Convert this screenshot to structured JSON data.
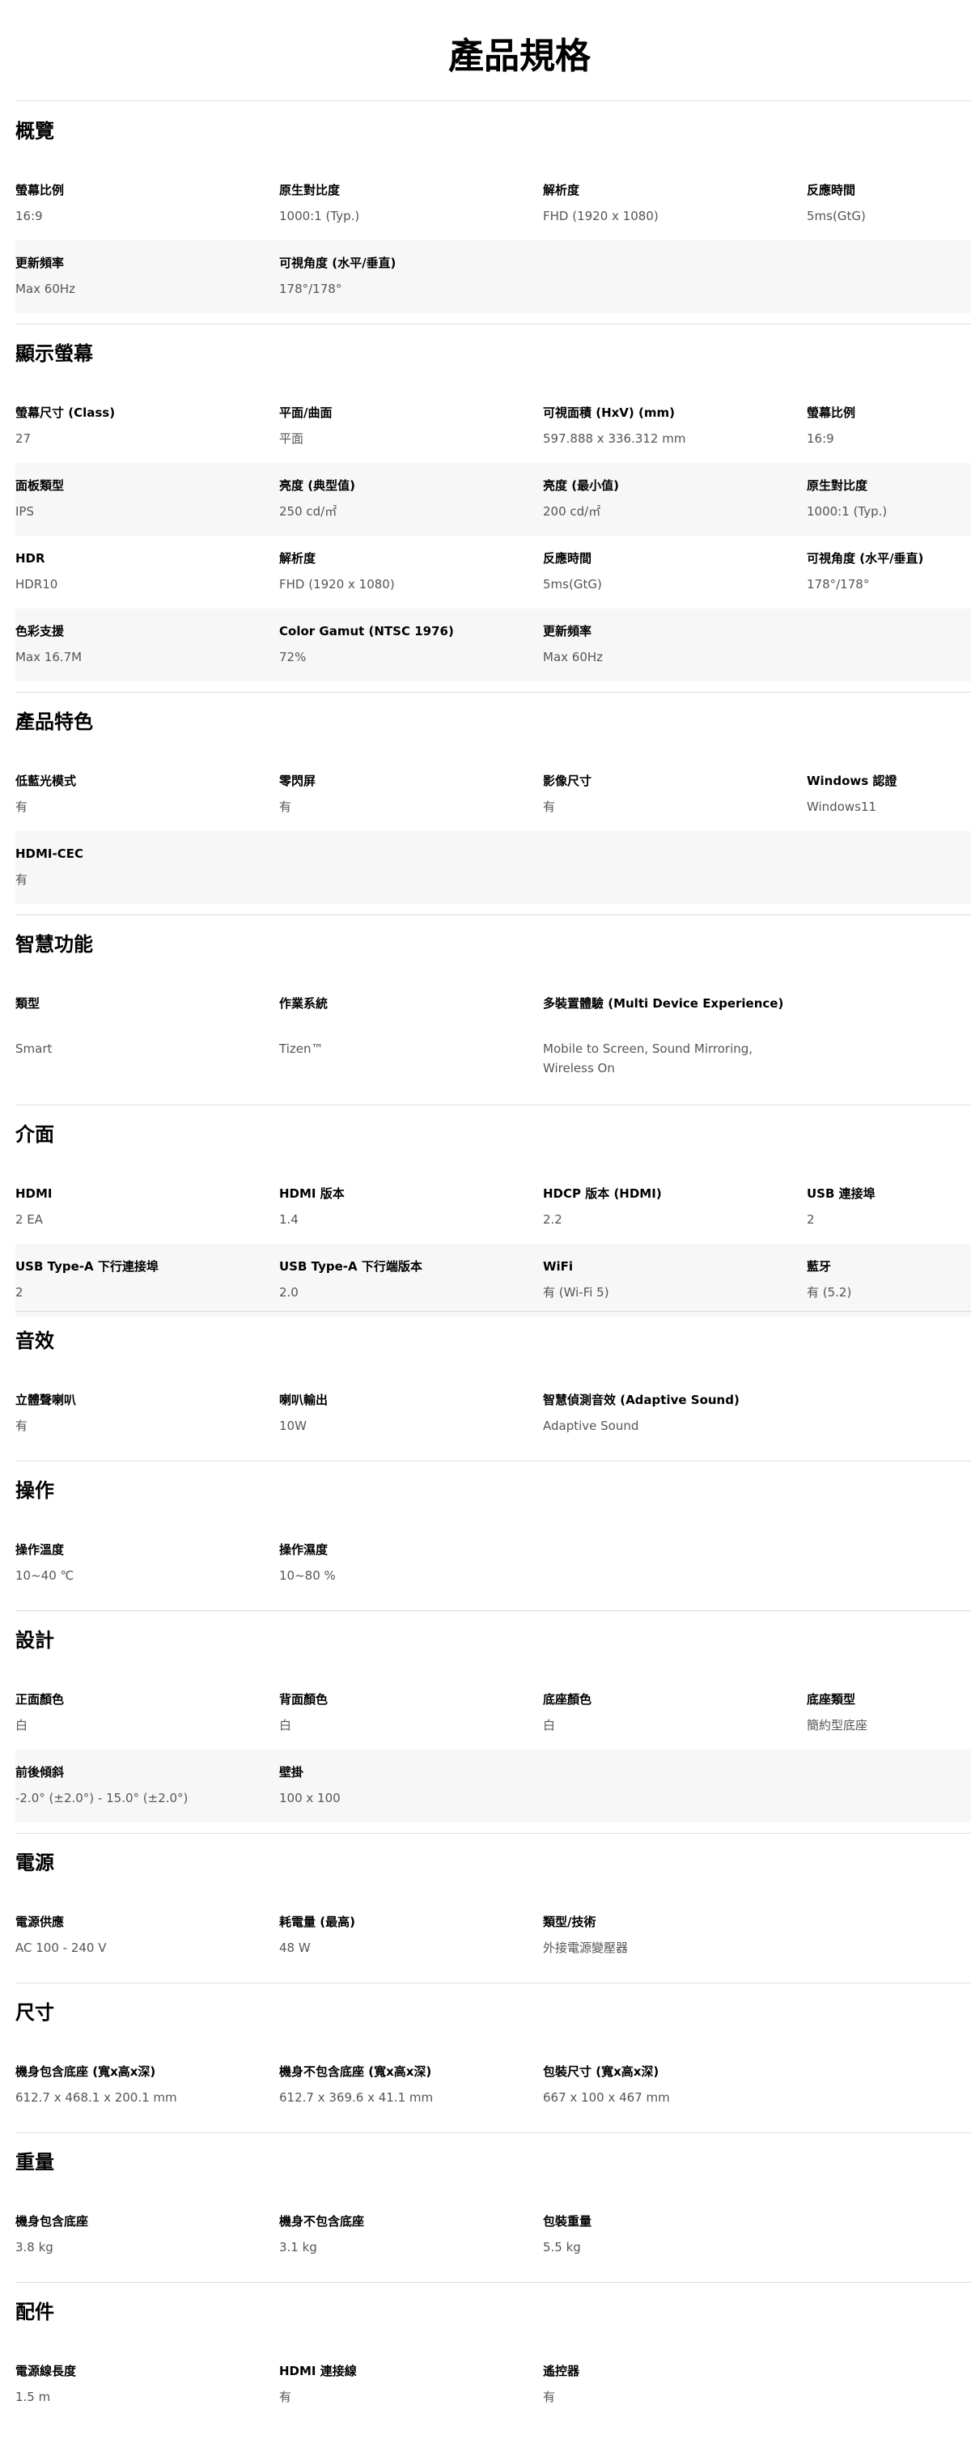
{
  "title": "產品規格",
  "sections": [
    {
      "title": "概覽",
      "rows": [
        [
          {
            "label": "螢幕比例",
            "value": "16:9"
          },
          {
            "label": "原生對比度",
            "value": "1000:1 (Typ.)"
          },
          {
            "label": "解析度",
            "value": "FHD (1920 x 1080)"
          },
          {
            "label": "反應時間",
            "value": "5ms(GtG)"
          }
        ],
        [
          {
            "label": "更新頻率",
            "value": "Max 60Hz"
          },
          {
            "label": "可視角度 (水平/垂直)",
            "value": "178°/178°"
          }
        ]
      ]
    },
    {
      "title": "顯示螢幕",
      "rows": [
        [
          {
            "label": "螢幕尺寸 (Class)",
            "value": "27"
          },
          {
            "label": "平面/曲面",
            "value": "平面"
          },
          {
            "label": "可視面積 (HxV) (mm)",
            "value": "597.888 x 336.312 mm"
          },
          {
            "label": "螢幕比例",
            "value": "16:9"
          }
        ],
        [
          {
            "label": "面板類型",
            "value": "IPS"
          },
          {
            "label": "亮度 (典型值)",
            "value": "250 cd/㎡"
          },
          {
            "label": "亮度 (最小值)",
            "value": "200 cd/㎡"
          },
          {
            "label": "原生對比度",
            "value": "1000:1 (Typ.)"
          }
        ],
        [
          {
            "label": "HDR",
            "value": "HDR10"
          },
          {
            "label": "解析度",
            "value": "FHD (1920 x 1080)"
          },
          {
            "label": "反應時間",
            "value": "5ms(GtG)"
          },
          {
            "label": "可視角度 (水平/垂直)",
            "value": "178°/178°"
          }
        ],
        [
          {
            "label": "色彩支援",
            "value": "Max 16.7M"
          },
          {
            "label": "Color Gamut (NTSC 1976)",
            "value": "72%"
          },
          {
            "label": "更新頻率",
            "value": "Max 60Hz"
          }
        ]
      ]
    },
    {
      "title": "產品特色",
      "rows": [
        [
          {
            "label": "低藍光模式",
            "value": "有"
          },
          {
            "label": "零閃屏",
            "value": "有"
          },
          {
            "label": "影像尺寸",
            "value": "有"
          },
          {
            "label": "Windows 認證",
            "value": "Windows11"
          }
        ],
        [
          {
            "label": "HDMI-CEC",
            "value": "有"
          }
        ]
      ]
    },
    {
      "title": "智慧功能",
      "rows": [
        [
          {
            "label": "類型",
            "value": "Smart"
          },
          {
            "label": "作業系統",
            "value": "Tizen™"
          },
          {
            "label": "多裝置體驗 (Multi Device Experience)",
            "value": "Mobile to Screen, Sound Mirroring, Wireless On"
          }
        ]
      ]
    },
    {
      "title": "介面",
      "rows": [
        [
          {
            "label": "HDMI",
            "value": "2 EA"
          },
          {
            "label": "HDMI 版本",
            "value": "1.4"
          },
          {
            "label": "HDCP 版本 (HDMI)",
            "value": "2.2"
          },
          {
            "label": "USB 連接埠",
            "value": "2"
          }
        ],
        [
          {
            "label": "USB Type-A 下行連接埠",
            "value": "2"
          },
          {
            "label": "USB Type-A 下行端版本",
            "value": "2.0"
          },
          {
            "label": "WiFi",
            "value": "有 (Wi-Fi 5)"
          },
          {
            "label": "藍牙",
            "value": "有 (5.2)"
          }
        ]
      ]
    },
    {
      "title": "音效",
      "rows": [
        [
          {
            "label": "立體聲喇叭",
            "value": "有"
          },
          {
            "label": "喇叭輸出",
            "value": "10W"
          },
          {
            "label": "智慧偵測音效 (Adaptive Sound)",
            "value": "Adaptive Sound"
          }
        ]
      ]
    },
    {
      "title": "操作",
      "rows": [
        [
          {
            "label": "操作溫度",
            "value": "10~40 ℃"
          },
          {
            "label": "操作濕度",
            "value": "10~80 %"
          }
        ]
      ]
    },
    {
      "title": "設計",
      "rows": [
        [
          {
            "label": "正面顏色",
            "value": "白"
          },
          {
            "label": "背面顏色",
            "value": "白"
          },
          {
            "label": "底座顏色",
            "value": "白"
          },
          {
            "label": "底座類型",
            "value": "簡約型底座"
          }
        ],
        [
          {
            "label": "前後傾斜",
            "value": "-2.0° (±2.0°) - 15.0° (±2.0°)"
          },
          {
            "label": "壁掛",
            "value": "100 x 100"
          }
        ]
      ]
    },
    {
      "title": "電源",
      "rows": [
        [
          {
            "label": "電源供應",
            "value": "AC 100 - 240 V"
          },
          {
            "label": "耗電量 (最高)",
            "value": "48 W"
          },
          {
            "label": "類型/技術",
            "value": "外接電源變壓器"
          }
        ]
      ]
    },
    {
      "title": "尺寸",
      "rows": [
        [
          {
            "label": "機身包含底座 (寬x高x深)",
            "value": "612.7 x 468.1 x 200.1 mm"
          },
          {
            "label": "機身不包含底座 (寬x高x深)",
            "value": "612.7 x 369.6 x 41.1 mm"
          },
          {
            "label": "包裝尺寸 (寬x高x深)",
            "value": "667 x 100 x 467 mm"
          }
        ]
      ]
    },
    {
      "title": "重量",
      "rows": [
        [
          {
            "label": "機身包含底座",
            "value": "3.8 kg"
          },
          {
            "label": "機身不包含底座",
            "value": "3.1 kg"
          },
          {
            "label": "包裝重量",
            "value": "5.5 kg"
          }
        ]
      ]
    },
    {
      "title": "配件",
      "rows": [
        [
          {
            "label": "電源線長度",
            "value": "1.5 m"
          },
          {
            "label": "HDMI 連接線",
            "value": "有"
          },
          {
            "label": "遙控器",
            "value": "有"
          }
        ]
      ]
    }
  ]
}
